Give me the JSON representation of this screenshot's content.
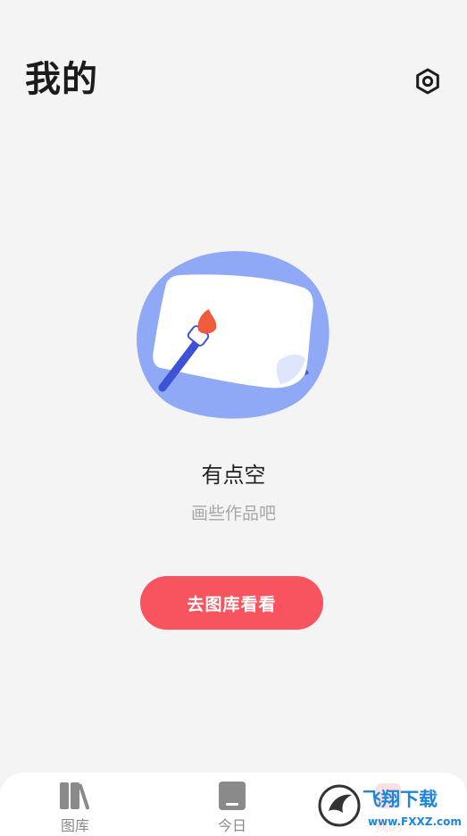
{
  "header": {
    "title": "我的",
    "settings_icon": "hexagon-settings-icon"
  },
  "empty_state": {
    "illustration": "paper-and-paintbrush",
    "title": "有点空",
    "subtitle": "画些作品吧",
    "button_label": "去图库看看"
  },
  "bottom_nav": {
    "items": [
      {
        "label": "图库",
        "icon": "books-icon",
        "active": false
      },
      {
        "label": "今日",
        "icon": "tablet-icon",
        "active": false
      },
      {
        "label": "我的",
        "icon": "profile-icon",
        "active": true
      }
    ]
  },
  "watermark": {
    "brand": "飞翔下载",
    "url": "www.FXXZ.com"
  },
  "colors": {
    "accent": "#f8545f",
    "background": "#f4f4f4",
    "illustration_blue": "#8fa9f7",
    "brush_blue": "#3f52d6",
    "muted_text": "#a7a7a7"
  }
}
